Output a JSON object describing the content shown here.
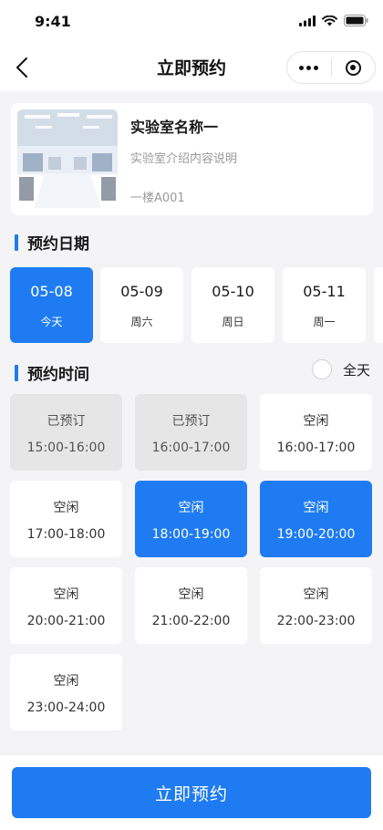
{
  "status_bar": {
    "time": "9:41"
  },
  "nav": {
    "title": "立即预约"
  },
  "lab": {
    "name": "实验室名称一",
    "description": "实验室介绍内容说明",
    "location": "一楼A001"
  },
  "date_section": {
    "title": "预约日期"
  },
  "dates": [
    {
      "date": "05-08",
      "weekday": "今天",
      "selected": true
    },
    {
      "date": "05-09",
      "weekday": "周六",
      "selected": false
    },
    {
      "date": "05-10",
      "weekday": "周日",
      "selected": false
    },
    {
      "date": "05-11",
      "weekday": "周一",
      "selected": false
    }
  ],
  "time_section": {
    "title": "预约时间",
    "all_day_label": "全天"
  },
  "slots": [
    {
      "status": "已预订",
      "time": "15:00-16:00",
      "state": "booked"
    },
    {
      "status": "已预订",
      "time": "16:00-17:00",
      "state": "booked"
    },
    {
      "status": "空闲",
      "time": "16:00-17:00",
      "state": "free"
    },
    {
      "status": "空闲",
      "time": "17:00-18:00",
      "state": "free"
    },
    {
      "status": "空闲",
      "time": "18:00-19:00",
      "state": "selected"
    },
    {
      "status": "空闲",
      "time": "19:00-20:00",
      "state": "selected"
    },
    {
      "status": "空闲",
      "time": "20:00-21:00",
      "state": "free"
    },
    {
      "status": "空闲",
      "time": "21:00-22:00",
      "state": "free"
    },
    {
      "status": "空闲",
      "time": "22:00-23:00",
      "state": "free"
    },
    {
      "status": "空闲",
      "time": "23:00-24:00",
      "state": "free"
    }
  ],
  "footer": {
    "submit_label": "立即预约"
  },
  "colors": {
    "accent": "#1e7bf2",
    "booked": "#e6e6e6",
    "background": "#f4f4f6"
  }
}
